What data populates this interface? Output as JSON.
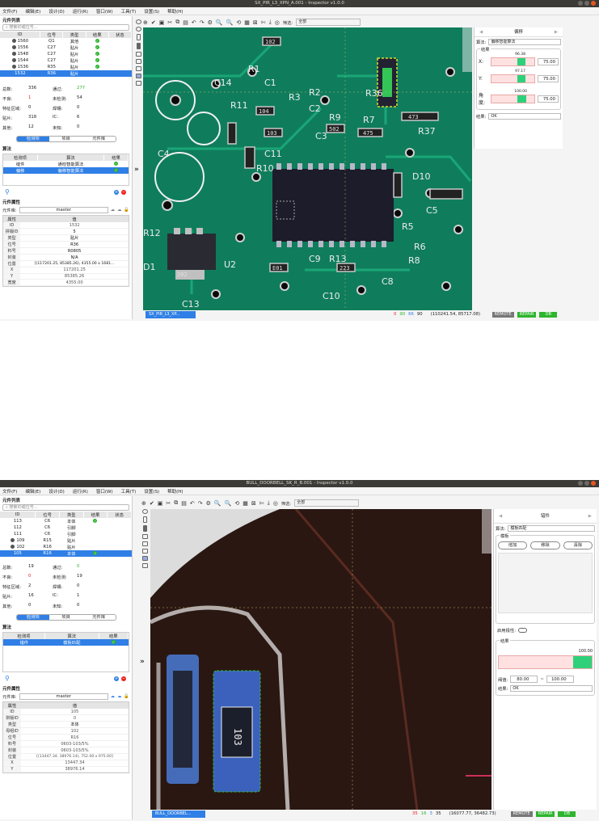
{
  "w1": {
    "title": "SX_PIR_L3_XPN_A.001 - Inspector v1.0.0",
    "menu": [
      "文件(F)",
      "编辑(E)",
      "设计(D)",
      "运行(R)",
      "窗口(W)",
      "工具(T)",
      "设置(S)",
      "帮助(H)"
    ],
    "panel_title": "元件列表",
    "search_placeholder": "搜索ID或位号...",
    "cols": [
      "ID",
      "位号",
      "类型",
      "结果",
      "状态"
    ],
    "rows": [
      [
        "1560",
        "Q1",
        "其他"
      ],
      [
        "1556",
        "C27",
        "贴片"
      ],
      [
        "1548",
        "C27",
        "贴片"
      ],
      [
        "1544",
        "C27",
        "贴片"
      ],
      [
        "1536",
        "R35",
        "贴片"
      ],
      [
        "1532",
        "R36",
        "贴片"
      ]
    ],
    "stats": [
      [
        "总数:",
        "336",
        "通过:",
        "277"
      ],
      [
        "不良:",
        "1",
        "未检测:",
        "54"
      ],
      [
        "特征区域:",
        "0",
        "焊锡:",
        "0"
      ],
      [
        "贴片:",
        "318",
        "IC:",
        "6"
      ],
      [
        "其他:",
        "12",
        "未知:",
        "0"
      ]
    ],
    "tabs": [
      "检测项",
      "项目",
      "元件库"
    ],
    "algo_title": "算法",
    "algo_cols": [
      "检测项",
      "算法",
      "结果"
    ],
    "algo_rows": [
      [
        "缝件",
        "通检智能算法"
      ],
      [
        "偏移",
        "偏移智能算法"
      ]
    ],
    "prop_title": "元件属性",
    "lib_label": "元件库:",
    "lib_value": "master",
    "prop_cols": [
      "属性",
      "值"
    ],
    "props": [
      [
        "ID",
        "1532"
      ],
      [
        "拼版ID",
        "5"
      ],
      [
        "类型",
        "贴片"
      ],
      [
        "位号",
        "R36"
      ],
      [
        "料号",
        "R0805"
      ],
      [
        "封装",
        "N/A"
      ],
      [
        "位置",
        "[(117201.25, 85385.26), 4355.00 x 1681..."
      ],
      [
        "X",
        "117201.25"
      ],
      [
        "Y",
        "85385.26"
      ],
      [
        "宽度",
        "4355.00"
      ]
    ],
    "filter_label": "筛选:",
    "filter_value": "全部",
    "img_tab": "SX_PIR_L3_XP...",
    "status_counts": [
      "0",
      "90",
      "66",
      "90"
    ],
    "coords": "(110241.54, 85717.08)",
    "btns": [
      "REMOTE",
      "REPAIR",
      "DB"
    ],
    "right": {
      "header": "偏移",
      "algo_label": "算法:",
      "algo_value": "偏移智能算法",
      "result_label": "结果",
      "x_label": "X:",
      "x_val": "96.38",
      "x_box": "75.00",
      "y_label": "Y:",
      "y_val": "97.17",
      "y_box": "75.00",
      "a_label": "角度:",
      "a_val": "100.00",
      "a_box": "75.00",
      "res_label": "结果:",
      "res_value": "OK"
    },
    "pcb_labels": [
      "C14",
      "R3",
      "R2",
      "C1",
      "C2",
      "R36",
      "C4",
      "R11",
      "R9",
      "R7",
      "R37",
      "D10",
      "C3",
      "C5",
      "R6",
      "U2",
      "C8",
      "C10",
      "R13",
      "R8",
      "C9",
      "C13",
      "R1",
      "C11",
      "R10",
      "R12",
      "R5",
      "D1",
      "102",
      "104",
      "103",
      "502",
      "475",
      "473",
      "202",
      "223",
      "E01"
    ]
  },
  "w2": {
    "title": "BULL_DOORBELL_SK_R_B.001 - Inspector v1.0.0",
    "menu": [
      "文件(F)",
      "编辑(E)",
      "设计(D)",
      "运行(R)",
      "窗口(W)",
      "工具(T)",
      "设置(S)",
      "帮助(H)"
    ],
    "panel_title": "元件列表",
    "search_placeholder": "搜索ID或位号...",
    "cols": [
      "ID",
      "位号",
      "类型",
      "结果",
      "状态"
    ],
    "rows": [
      [
        "113",
        "C6",
        "本体"
      ],
      [
        "112",
        "C6",
        "引脚"
      ],
      [
        "111",
        "C6",
        "引脚"
      ],
      [
        "109",
        "R15",
        "贴片"
      ],
      [
        "102",
        "R16",
        "贴片"
      ],
      [
        "105",
        "R16",
        "本体"
      ]
    ],
    "stats": [
      [
        "总数:",
        "19",
        "通过:",
        "0"
      ],
      [
        "不良:",
        "0",
        "未检测:",
        "19"
      ],
      [
        "特征区域:",
        "2",
        "焊锡:",
        "0"
      ],
      [
        "贴片:",
        "16",
        "IC:",
        "1"
      ],
      [
        "其他:",
        "0",
        "未知:",
        "0"
      ]
    ],
    "tabs": [
      "检测项",
      "项目",
      "元件库"
    ],
    "algo_title": "算法",
    "algo_cols": [
      "检测项",
      "算法",
      "结果"
    ],
    "algo_rows": [
      [
        "错件",
        "模板匹配"
      ]
    ],
    "prop_title": "元件属性",
    "lib_label": "元件库:",
    "lib_value": "master",
    "prop_cols": [
      "属性",
      "值"
    ],
    "props": [
      [
        "ID",
        "105"
      ],
      [
        "拼版ID",
        "0"
      ],
      [
        "类型",
        "本体"
      ],
      [
        "母组ID",
        "102"
      ],
      [
        "位号",
        "R16"
      ],
      [
        "料号",
        "0603-103/5%"
      ],
      [
        "封装",
        "0603-103/5%"
      ],
      [
        "位置",
        "[(13447.34, 38976.14), 752.00 x 975.00]"
      ],
      [
        "X",
        "13447.34"
      ],
      [
        "Y",
        "38976.14"
      ]
    ],
    "filter_label": "筛选:",
    "filter_value": "全部",
    "img_tab": "BULL_DOORBEL...",
    "status_counts": [
      "35",
      "16",
      "3",
      "35"
    ],
    "coords": "(16077.77, 36482.73)",
    "btns": [
      "REMOTE",
      "REPAIR",
      "DB"
    ],
    "right": {
      "header": "错件",
      "algo_label": "算法:",
      "algo_value": "模板匹配",
      "tpl_label": "模板",
      "tpl_btns": [
        "增加",
        "移除",
        "清除"
      ],
      "polarity": "启用极性:",
      "result_label": "结果",
      "score": "100.00",
      "thr_label": "阈值:",
      "thr_min": "80.00",
      "thr_dash": "~",
      "thr_max": "100.00",
      "res_label": "结果:",
      "res_value": "OK"
    },
    "comp_text": "103"
  }
}
